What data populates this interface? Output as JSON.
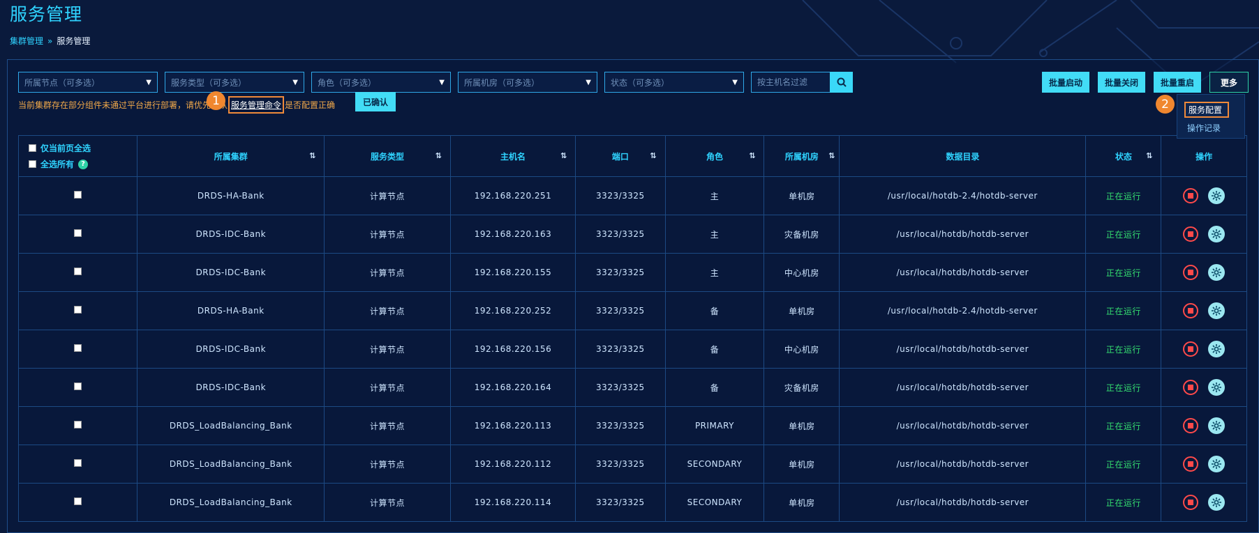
{
  "page": {
    "title": "服务管理",
    "breadcrumb": {
      "parent": "集群管理",
      "separator": "»",
      "current": "服务管理"
    }
  },
  "filters": [
    {
      "name": "node",
      "placeholder": "所属节点（可多选）"
    },
    {
      "name": "service_type",
      "placeholder": "服务类型（可多选）"
    },
    {
      "name": "role",
      "placeholder": "角色（可多选）"
    },
    {
      "name": "room",
      "placeholder": "所属机房（可多选）"
    },
    {
      "name": "status",
      "placeholder": "状态（可多选）"
    }
  ],
  "search": {
    "placeholder": "按主机名过滤",
    "icon": "search-icon"
  },
  "actions": {
    "batch_start": "批量启动",
    "batch_stop": "批量关闭",
    "batch_restart": "批量重启",
    "more": "更多"
  },
  "more_menu": {
    "items": [
      "服务配置",
      "操作记录"
    ]
  },
  "notice": {
    "prefix": "当前集群存在部分组件未通过平台进行部署，请优先确认",
    "link": "服务管理命令",
    "suffix": "是否配置正确",
    "confirm": "已确认"
  },
  "markers": {
    "m1": "1",
    "m2": "2"
  },
  "table": {
    "select_page": "仅当前页全选",
    "select_all": "全选所有",
    "help": "?",
    "sort_icon": "sort-icon",
    "headers": [
      "所属集群",
      "服务类型",
      "主机名",
      "端口",
      "角色",
      "所属机房",
      "数据目录",
      "状态",
      "操作"
    ],
    "rows": [
      {
        "cluster": "DRDS-HA-Bank",
        "type": "计算节点",
        "host": "192.168.220.251",
        "port": "3323/3325",
        "role": "主",
        "room": "单机房",
        "dir": "/usr/local/hotdb-2.4/hotdb-server",
        "status": "正在运行"
      },
      {
        "cluster": "DRDS-IDC-Bank",
        "type": "计算节点",
        "host": "192.168.220.163",
        "port": "3323/3325",
        "role": "主",
        "room": "灾备机房",
        "dir": "/usr/local/hotdb/hotdb-server",
        "status": "正在运行"
      },
      {
        "cluster": "DRDS-IDC-Bank",
        "type": "计算节点",
        "host": "192.168.220.155",
        "port": "3323/3325",
        "role": "主",
        "room": "中心机房",
        "dir": "/usr/local/hotdb/hotdb-server",
        "status": "正在运行"
      },
      {
        "cluster": "DRDS-HA-Bank",
        "type": "计算节点",
        "host": "192.168.220.252",
        "port": "3323/3325",
        "role": "备",
        "room": "单机房",
        "dir": "/usr/local/hotdb-2.4/hotdb-server",
        "status": "正在运行"
      },
      {
        "cluster": "DRDS-IDC-Bank",
        "type": "计算节点",
        "host": "192.168.220.156",
        "port": "3323/3325",
        "role": "备",
        "room": "中心机房",
        "dir": "/usr/local/hotdb/hotdb-server",
        "status": "正在运行"
      },
      {
        "cluster": "DRDS-IDC-Bank",
        "type": "计算节点",
        "host": "192.168.220.164",
        "port": "3323/3325",
        "role": "备",
        "room": "灾备机房",
        "dir": "/usr/local/hotdb/hotdb-server",
        "status": "正在运行"
      },
      {
        "cluster": "DRDS_LoadBalancing_Bank",
        "type": "计算节点",
        "host": "192.168.220.113",
        "port": "3323/3325",
        "role": "PRIMARY",
        "room": "单机房",
        "dir": "/usr/local/hotdb/hotdb-server",
        "status": "正在运行"
      },
      {
        "cluster": "DRDS_LoadBalancing_Bank",
        "type": "计算节点",
        "host": "192.168.220.112",
        "port": "3323/3325",
        "role": "SECONDARY",
        "room": "单机房",
        "dir": "/usr/local/hotdb/hotdb-server",
        "status": "正在运行"
      },
      {
        "cluster": "DRDS_LoadBalancing_Bank",
        "type": "计算节点",
        "host": "192.168.220.114",
        "port": "3323/3325",
        "role": "SECONDARY",
        "room": "单机房",
        "dir": "/usr/local/hotdb/hotdb-server",
        "status": "正在运行"
      }
    ]
  },
  "colors": {
    "accent": "#2fd3ff",
    "button": "#42dcf6",
    "running": "#35e070",
    "stop": "#ff4a4a",
    "marker": "#f0872f"
  }
}
